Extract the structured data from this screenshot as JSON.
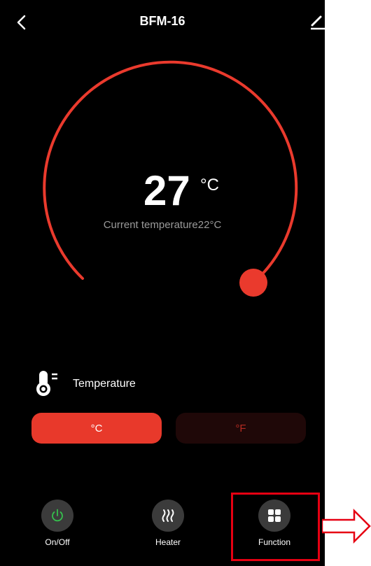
{
  "header": {
    "title": "BFM-16",
    "back_icon": "chevron-left-icon",
    "edit_icon": "pencil-icon"
  },
  "thermostat": {
    "set_temperature": "27",
    "unit": "°C",
    "current_label": "Current temperature22°C",
    "accent_color": "#ea3a2d"
  },
  "temperature_section": {
    "label": "Temperature",
    "icon": "thermometer-icon",
    "options": [
      {
        "label": "°C",
        "selected": true
      },
      {
        "label": "°F",
        "selected": false
      }
    ]
  },
  "bottom_bar": {
    "items": [
      {
        "label": "On/Off",
        "icon": "power-icon",
        "color": "#35c04d"
      },
      {
        "label": "Heater",
        "icon": "heater-icon"
      },
      {
        "label": "Function",
        "icon": "grid-icon",
        "highlighted": true
      }
    ]
  },
  "annotation": {
    "color": "#e60012"
  }
}
